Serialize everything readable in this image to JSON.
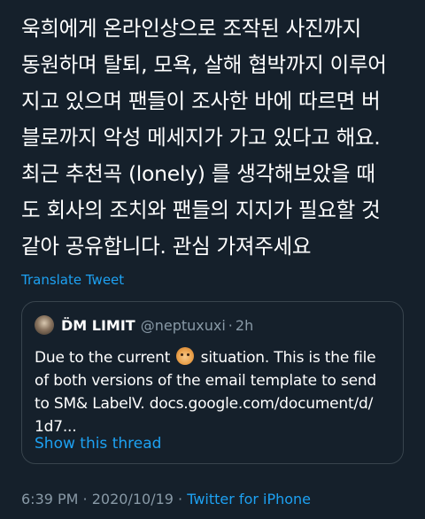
{
  "tweet": {
    "lines": [
      "욱희에게 온라인상으로 조작된 사진까지",
      "동원하며 탈퇴, 모욕, 살해 협박까지 이루어",
      "지고 있으며 팬들이 조사한 바에 따르면 버",
      "블로까지 악성 메세지가 가고 있다고 해요.",
      "최근 추천곡 (lonely) 를 생각해보았을 때",
      "도 회사의 조치와 팬들의 지지가 필요할 것",
      "같아 공유합니다. 관심 가져주세요"
    ],
    "translate_label": "Translate Tweet"
  },
  "quote": {
    "name": "D̈M LIMIT",
    "handle": "@neptuxuxi",
    "separator": "·",
    "time": "2h",
    "avatar_icon": "avatar-image",
    "line1_before": "Due to the current",
    "line1_emoji": "face-emoji",
    "line1_after": "situation. This is the file",
    "line2": "of both versions of the email template to send",
    "line3": "to SM& LabelV. docs.google.com/document/d/",
    "line4": "1d7...",
    "show_thread_label": "Show this thread"
  },
  "meta": {
    "time": "6:39 PM",
    "separator1": " · ",
    "date": "2020/10/19",
    "separator2": " · ",
    "source": "Twitter for iPhone"
  },
  "colors": {
    "background": "#15202b",
    "text": "#ffffff",
    "secondary": "#8899a6",
    "accent": "#1da1f2",
    "border": "#38444d"
  }
}
